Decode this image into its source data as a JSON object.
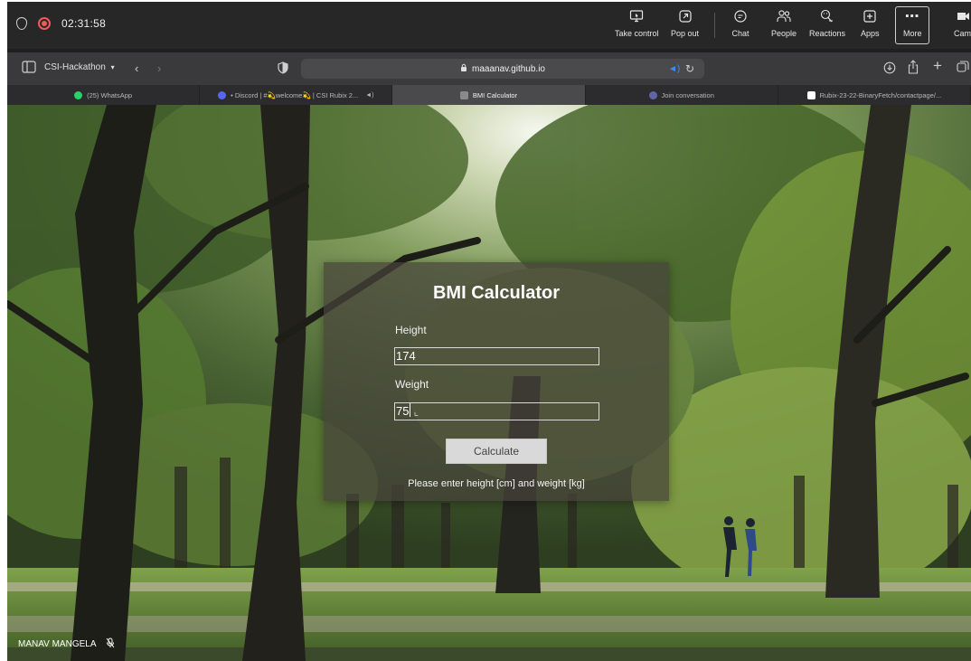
{
  "meeting": {
    "timer": "02:31:58",
    "buttons": [
      {
        "label": "Take control",
        "icon": "take-control-icon"
      },
      {
        "label": "Pop out",
        "icon": "pop-out-icon"
      },
      {
        "label": "Chat",
        "icon": "chat-icon"
      },
      {
        "label": "People",
        "icon": "people-icon"
      },
      {
        "label": "Reactions",
        "icon": "reactions-icon"
      },
      {
        "label": "Apps",
        "icon": "apps-icon"
      },
      {
        "label": "More",
        "icon": "more-icon"
      },
      {
        "label": "Cam",
        "icon": "camera-icon"
      }
    ]
  },
  "browser": {
    "tab_group": "CSI-Hackathon",
    "url": "maaanav.github.io",
    "tabs": [
      {
        "label": "(25) WhatsApp",
        "icon": "whatsapp-icon",
        "color": "#25d366",
        "active": false
      },
      {
        "label": "• Discord | #💫welcome💫 | CSI Rubix 2...",
        "icon": "discord-icon",
        "color": "#5865f2",
        "active": false
      },
      {
        "label": "BMI Calculator",
        "icon": "page-icon",
        "color": "#8a8a8a",
        "active": true
      },
      {
        "label": "Join conversation",
        "icon": "teams-icon",
        "color": "#6264a7",
        "active": false
      },
      {
        "label": "Rubix-23-22-BinaryFetch/contactpage/...",
        "icon": "github-icon",
        "color": "#ffffff",
        "active": false
      }
    ]
  },
  "app": {
    "title": "BMI Calculator",
    "height_label": "Height",
    "height_value": "174",
    "weight_label": "Weight",
    "weight_value": "75",
    "button_label": "Calculate",
    "message": "Please enter height [cm] and weight [kg]"
  },
  "participant": {
    "name": "MANAV MANGELA"
  }
}
